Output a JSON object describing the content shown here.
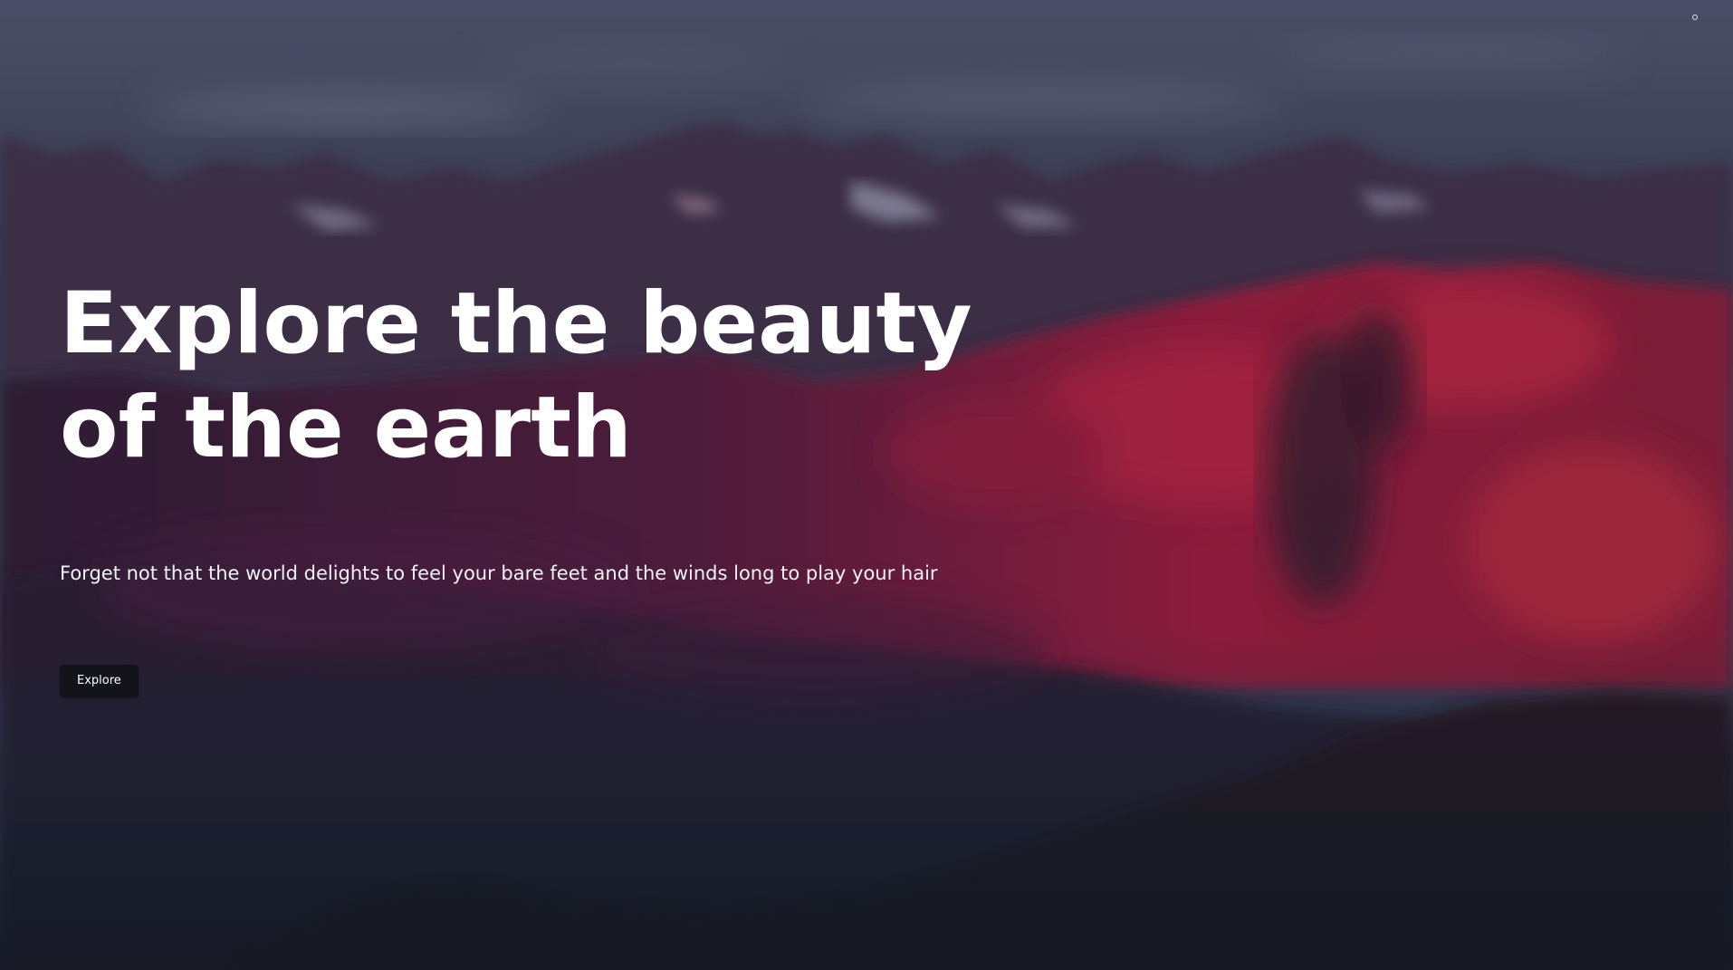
{
  "hero": {
    "title_line1": "Explore the beauty",
    "title_line2": "of the earth",
    "subtitle": "Forget not that the world delights to feel your bare feet and the winds long to play your hair",
    "button_label": "Explore"
  },
  "background": {
    "scene": "mountain-range-at-dusk",
    "sky_color": "#3e4258",
    "ridge_red": "#8a1e3a",
    "foreground_dark": "#15151f"
  },
  "icons": {
    "corner": "small-circle-icon"
  }
}
